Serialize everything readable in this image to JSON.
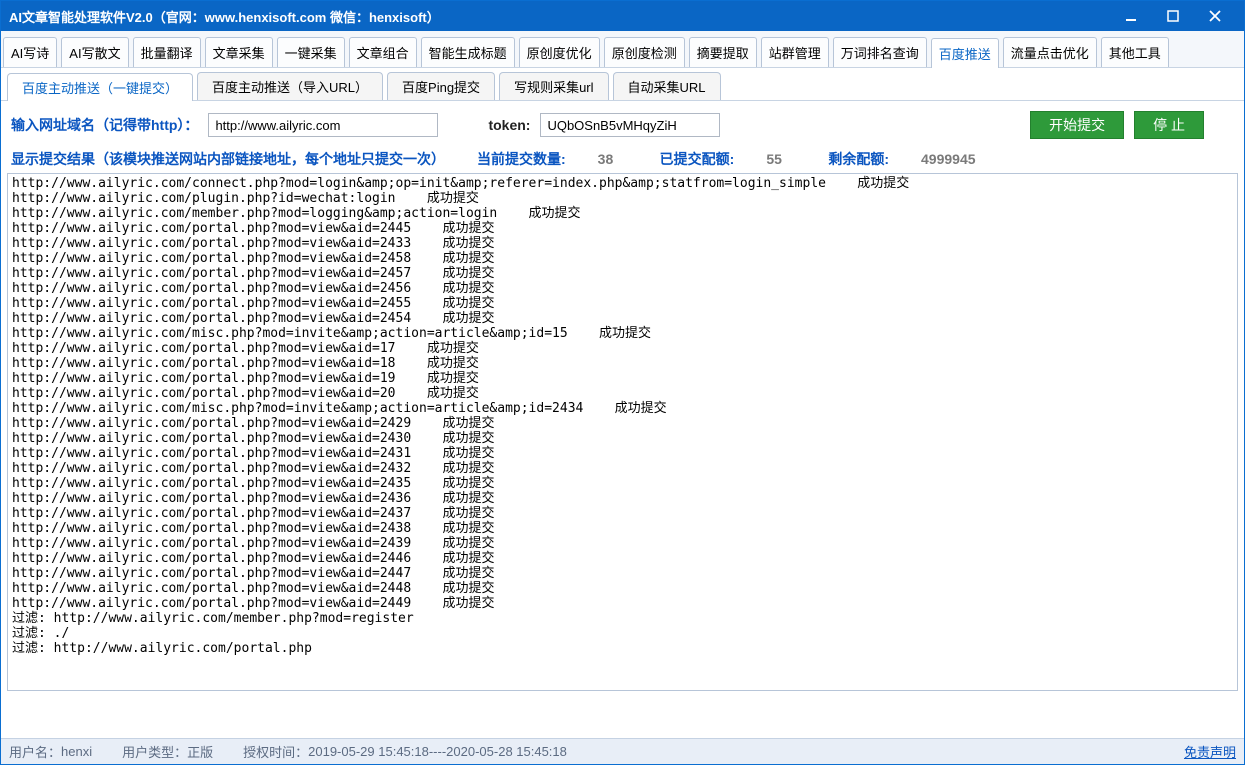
{
  "title": "AI文章智能处理软件V2.0（官网：www.henxisoft.com  微信：henxisoft）",
  "main_tabs": [
    "AI写诗",
    "AI写散文",
    "批量翻译",
    "文章采集",
    "一键采集",
    "文章组合",
    "智能生成标题",
    "原创度优化",
    "原创度检测",
    "摘要提取",
    "站群管理",
    "万词排名查询",
    "百度推送",
    "流量点击优化",
    "其他工具"
  ],
  "main_tab_active_index": 12,
  "sub_tabs": [
    "百度主动推送（一键提交）",
    "百度主动推送（导入URL）",
    "百度Ping提交",
    "写规则采集url",
    "自动采集URL"
  ],
  "sub_tab_active_index": 0,
  "form": {
    "domain_label": "输入网址域名（记得带http）：",
    "domain_value": "http://www.ailyric.com",
    "token_label": "token:",
    "token_value": "UQbOSnB5vMHqyZiH",
    "start_btn": "开始提交",
    "stop_btn": "停 止"
  },
  "stats": {
    "title": "显示提交结果（该模块推送网站内部链接地址，每个地址只提交一次）",
    "current_label": "当前提交数量:",
    "current_value": "38",
    "submitted_label": "已提交配额:",
    "submitted_value": "55",
    "remain_label": "剩余配额:",
    "remain_value": "4999945"
  },
  "output_lines": [
    "http://www.ailyric.com/connect.php?mod=login&amp;op=init&amp;referer=index.php&amp;statfrom=login_simple    成功提交",
    "http://www.ailyric.com/plugin.php?id=wechat:login    成功提交",
    "http://www.ailyric.com/member.php?mod=logging&amp;action=login    成功提交",
    "http://www.ailyric.com/portal.php?mod=view&aid=2445    成功提交",
    "http://www.ailyric.com/portal.php?mod=view&aid=2433    成功提交",
    "http://www.ailyric.com/portal.php?mod=view&aid=2458    成功提交",
    "http://www.ailyric.com/portal.php?mod=view&aid=2457    成功提交",
    "http://www.ailyric.com/portal.php?mod=view&aid=2456    成功提交",
    "http://www.ailyric.com/portal.php?mod=view&aid=2455    成功提交",
    "http://www.ailyric.com/portal.php?mod=view&aid=2454    成功提交",
    "http://www.ailyric.com/misc.php?mod=invite&amp;action=article&amp;id=15    成功提交",
    "http://www.ailyric.com/portal.php?mod=view&aid=17    成功提交",
    "http://www.ailyric.com/portal.php?mod=view&aid=18    成功提交",
    "http://www.ailyric.com/portal.php?mod=view&aid=19    成功提交",
    "http://www.ailyric.com/portal.php?mod=view&aid=20    成功提交",
    "http://www.ailyric.com/misc.php?mod=invite&amp;action=article&amp;id=2434    成功提交",
    "http://www.ailyric.com/portal.php?mod=view&aid=2429    成功提交",
    "http://www.ailyric.com/portal.php?mod=view&aid=2430    成功提交",
    "http://www.ailyric.com/portal.php?mod=view&aid=2431    成功提交",
    "http://www.ailyric.com/portal.php?mod=view&aid=2432    成功提交",
    "http://www.ailyric.com/portal.php?mod=view&aid=2435    成功提交",
    "http://www.ailyric.com/portal.php?mod=view&aid=2436    成功提交",
    "http://www.ailyric.com/portal.php?mod=view&aid=2437    成功提交",
    "http://www.ailyric.com/portal.php?mod=view&aid=2438    成功提交",
    "http://www.ailyric.com/portal.php?mod=view&aid=2439    成功提交",
    "http://www.ailyric.com/portal.php?mod=view&aid=2446    成功提交",
    "http://www.ailyric.com/portal.php?mod=view&aid=2447    成功提交",
    "http://www.ailyric.com/portal.php?mod=view&aid=2448    成功提交",
    "http://www.ailyric.com/portal.php?mod=view&aid=2449    成功提交",
    "",
    "过滤: http://www.ailyric.com/member.php?mod=register",
    "过滤: ./",
    "过滤: http://www.ailyric.com/portal.php"
  ],
  "footer": {
    "user_label": "用户名：",
    "user_value": "henxi",
    "type_label": "用户类型：",
    "type_value": "正版",
    "auth_label": "授权时间：",
    "auth_value": "2019-05-29 15:45:18----2020-05-28 15:45:18",
    "disclaimer": "免责声明"
  }
}
